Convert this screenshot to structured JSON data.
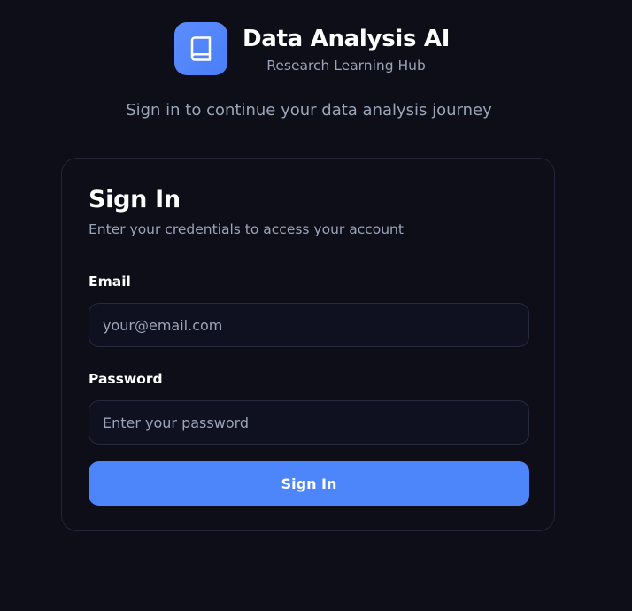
{
  "header": {
    "logo_icon": "book-icon",
    "app_title": "Data Analysis AI",
    "app_subtitle": "Research Learning Hub",
    "tagline": "Sign in to continue your data analysis journey"
  },
  "signin_card": {
    "title": "Sign In",
    "description": "Enter your credentials to access your account",
    "email": {
      "label": "Email",
      "value": "",
      "placeholder": "your@email.com"
    },
    "password": {
      "label": "Password",
      "value": "",
      "placeholder": "Enter your password"
    },
    "submit_label": "Sign In"
  },
  "colors": {
    "background": "#0d0e18",
    "accent": "#4d86fb",
    "muted_text": "#9aa4b8",
    "card_border": "#23263a"
  }
}
